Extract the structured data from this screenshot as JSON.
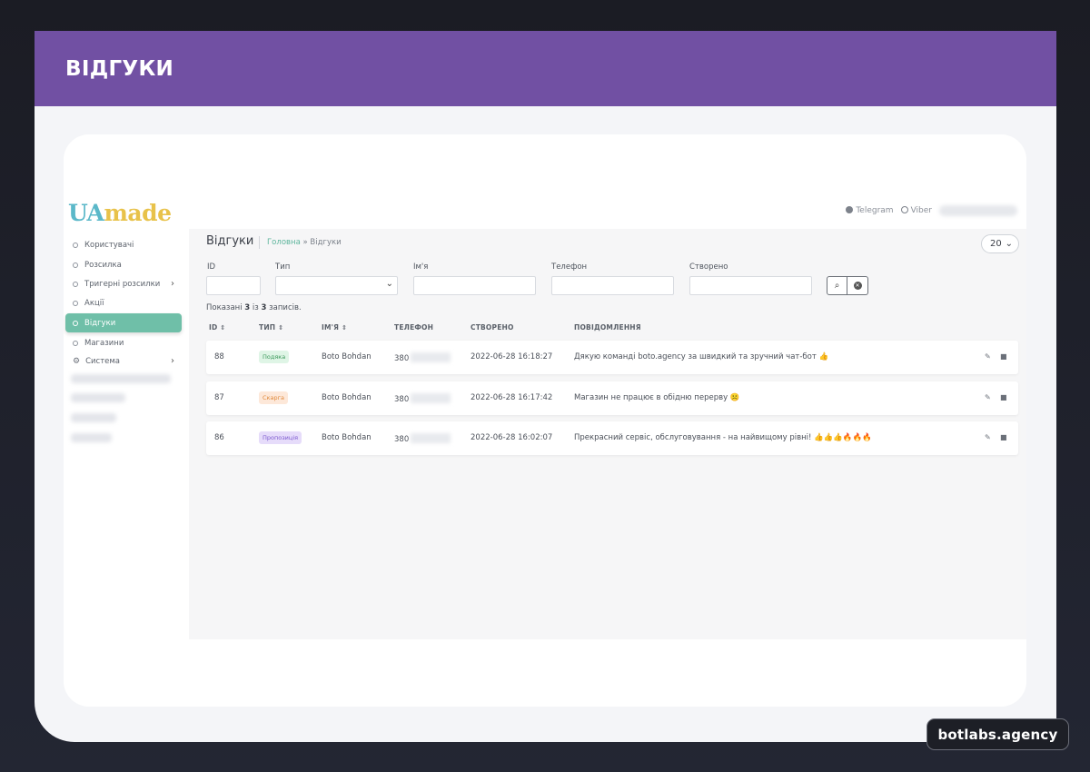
{
  "banner": {
    "title": "ВІДГУКИ"
  },
  "brand": {
    "logo_ua": "UA",
    "logo_made": "made",
    "footer": "botlabs.agency"
  },
  "topbar": {
    "telegram": "Telegram",
    "viber": "Viber"
  },
  "sidebar": {
    "items": [
      {
        "label": "Користувачі"
      },
      {
        "label": "Розсилка"
      },
      {
        "label": "Тригерні розсилки"
      },
      {
        "label": "Акції"
      },
      {
        "label": "Відгуки"
      },
      {
        "label": "Магазини"
      },
      {
        "label": "Система"
      }
    ]
  },
  "page": {
    "title": "Відгуки",
    "breadcrumb_home": "Головна",
    "breadcrumb_sep": "»",
    "breadcrumb_current": "Відгуки",
    "per_page": "20"
  },
  "filters": {
    "id_label": "ID",
    "type_label": "Тип",
    "name_label": "Ім'я",
    "phone_label": "Телефон",
    "created_label": "Створено"
  },
  "summary": {
    "prefix": "Показані",
    "from": "3",
    "mid": "із",
    "total": "3",
    "suffix": "записів."
  },
  "table": {
    "headers": {
      "id": "ID",
      "type": "ТИП",
      "name": "ІМ'Я",
      "phone": "ТЕЛЕФОН",
      "created": "СТВОРЕНО",
      "message": "ПОВІДОМЛЕННЯ"
    },
    "rows": [
      {
        "id": "88",
        "type": "Подяка",
        "name": "Boto Bohdan",
        "phone": "380",
        "created": "2022-06-28 16:18:27",
        "message": "Дякую команді boto.agency за швидкий та зручний чат-бот 👍"
      },
      {
        "id": "87",
        "type": "Скарга",
        "name": "Boto Bohdan",
        "phone": "380",
        "created": "2022-06-28 16:17:42",
        "message": "Магазин не працює в обідню перерву ☹️"
      },
      {
        "id": "86",
        "type": "Пропозиція",
        "name": "Boto Bohdan",
        "phone": "380",
        "created": "2022-06-28 16:02:07",
        "message": "Прекрасний сервіс, обслуговування - на найвищому рівні! 👍👍👍🔥🔥🔥"
      }
    ]
  },
  "colors": {
    "banner": "#7150a3",
    "accent": "#6fbfa8",
    "green_badge": "#3d9a5c",
    "orange_badge": "#e08a3c",
    "purple_badge": "#7e5bd0"
  }
}
